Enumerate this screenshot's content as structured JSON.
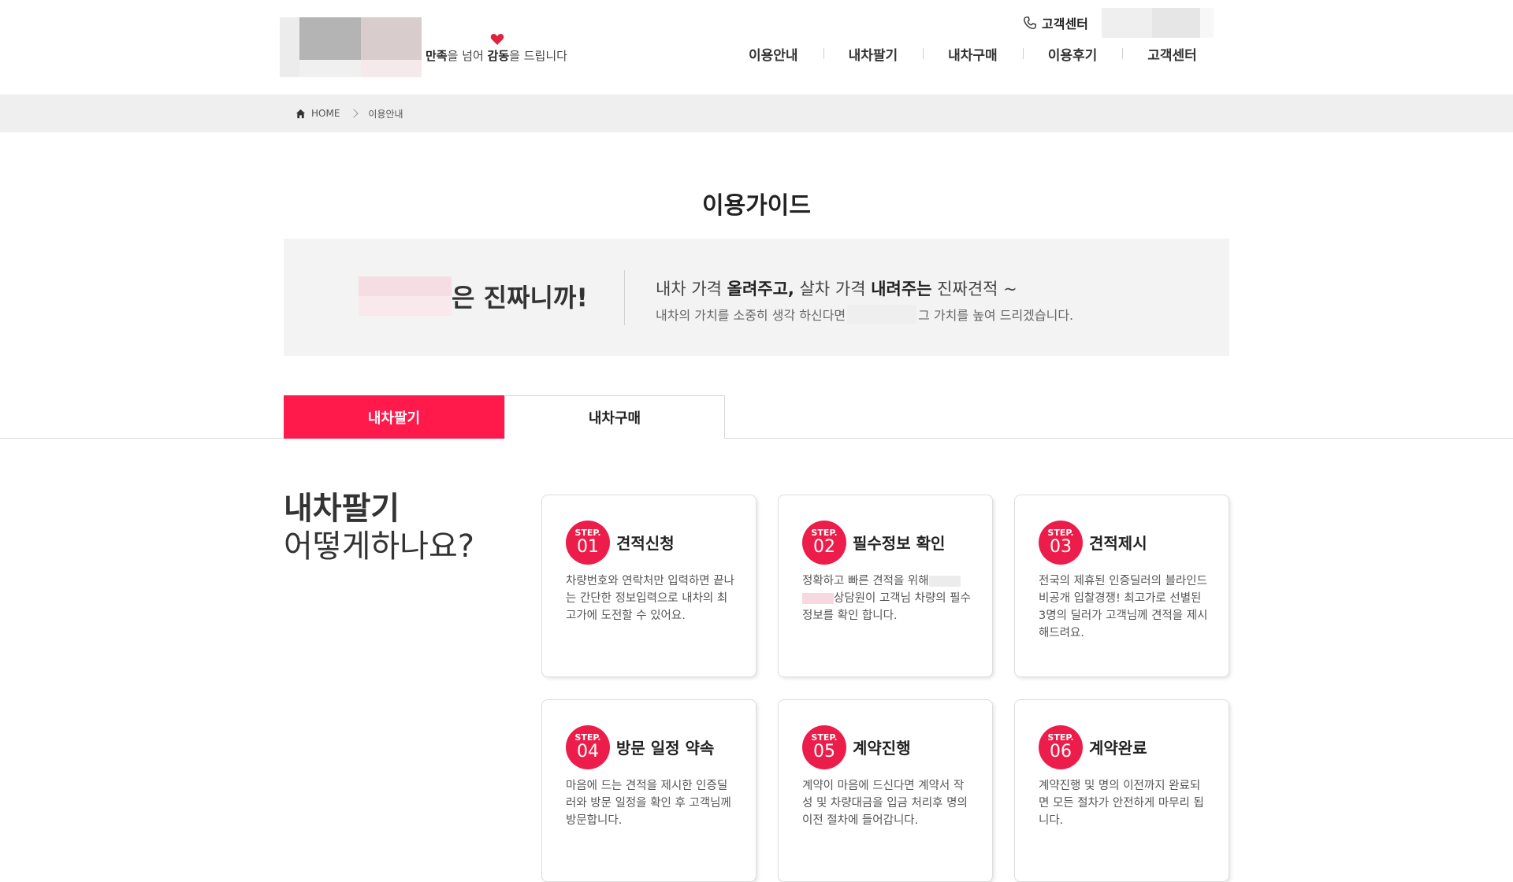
{
  "header": {
    "slogan_part1": "만족",
    "slogan_part2": "을 넘어 ",
    "slogan_part3": "감동",
    "slogan_part4": "을 드립니다",
    "cs_label": "고객센터",
    "nav": [
      "이용안내",
      "내차팔기",
      "내차구매",
      "이용후기",
      "고객센터"
    ]
  },
  "breadcrumb": {
    "home": "HOME",
    "current": "이용안내"
  },
  "guide": {
    "title": "이용가이드",
    "claim": "은 진짜니까!",
    "line1_part1": "내차 가격 ",
    "line1_part2": "올려주고,",
    "line1_part3": " 살차 가격 ",
    "line1_part4": "내려주는",
    "line1_part5": " 진짜견적 ~",
    "line2_part1": "내차의 가치를 소중히 생각 하신다면",
    "line2_part2": "그 가치를 높여 드리겠습니다."
  },
  "tabs": {
    "sell": "내차팔기",
    "buy": "내차구매",
    "active": "sell"
  },
  "howto": {
    "line1": "내차팔기",
    "line2": "어떻게하나요?"
  },
  "steps": [
    {
      "label": "STEP.",
      "num": "01",
      "title": "견적신청",
      "desc": "차량번호와 연락처만 입력하면 끝나는 간단한 정보입력으로 내차의 최고가에 도전할 수 있어요."
    },
    {
      "label": "STEP.",
      "num": "02",
      "title": "필수정보 확인",
      "desc_part1": "정확하고 빠른 견적을 위해",
      "desc_part2": "상담원이 고객님 차량의 필수정보를 확인 합니다."
    },
    {
      "label": "STEP.",
      "num": "03",
      "title": "견적제시",
      "desc": "전국의 제휴된 인증딜러의 블라인드 비공개 입찰경쟁! 최고가로 선별된 3명의 딜러가 고객님께 견적을 제시해드려요."
    },
    {
      "label": "STEP.",
      "num": "04",
      "title": "방문 일정 약속",
      "desc": "마음에 드는 견적을 제시한 인증딜러와 방문 일정을 확인 후 고객님께 방문합니다."
    },
    {
      "label": "STEP.",
      "num": "05",
      "title": "계약진행",
      "desc": "계약이 마음에 드신다면 계약서 작성 및 차량대금을 입금 처리후 명의 이전 절차에 들어갑니다."
    },
    {
      "label": "STEP.",
      "num": "06",
      "title": "계약완료",
      "desc": "계약진행 및 명의 이전까지 완료되면 모든 절차가 안전하게 마무리 됩니다."
    }
  ],
  "colors": {
    "accent": "#ff1a4b",
    "badge": "#ec1d4a",
    "gray_bg": "#efefef"
  },
  "icons": {
    "phone": "phone-icon",
    "heart": "heart-icon",
    "home": "home-icon"
  }
}
